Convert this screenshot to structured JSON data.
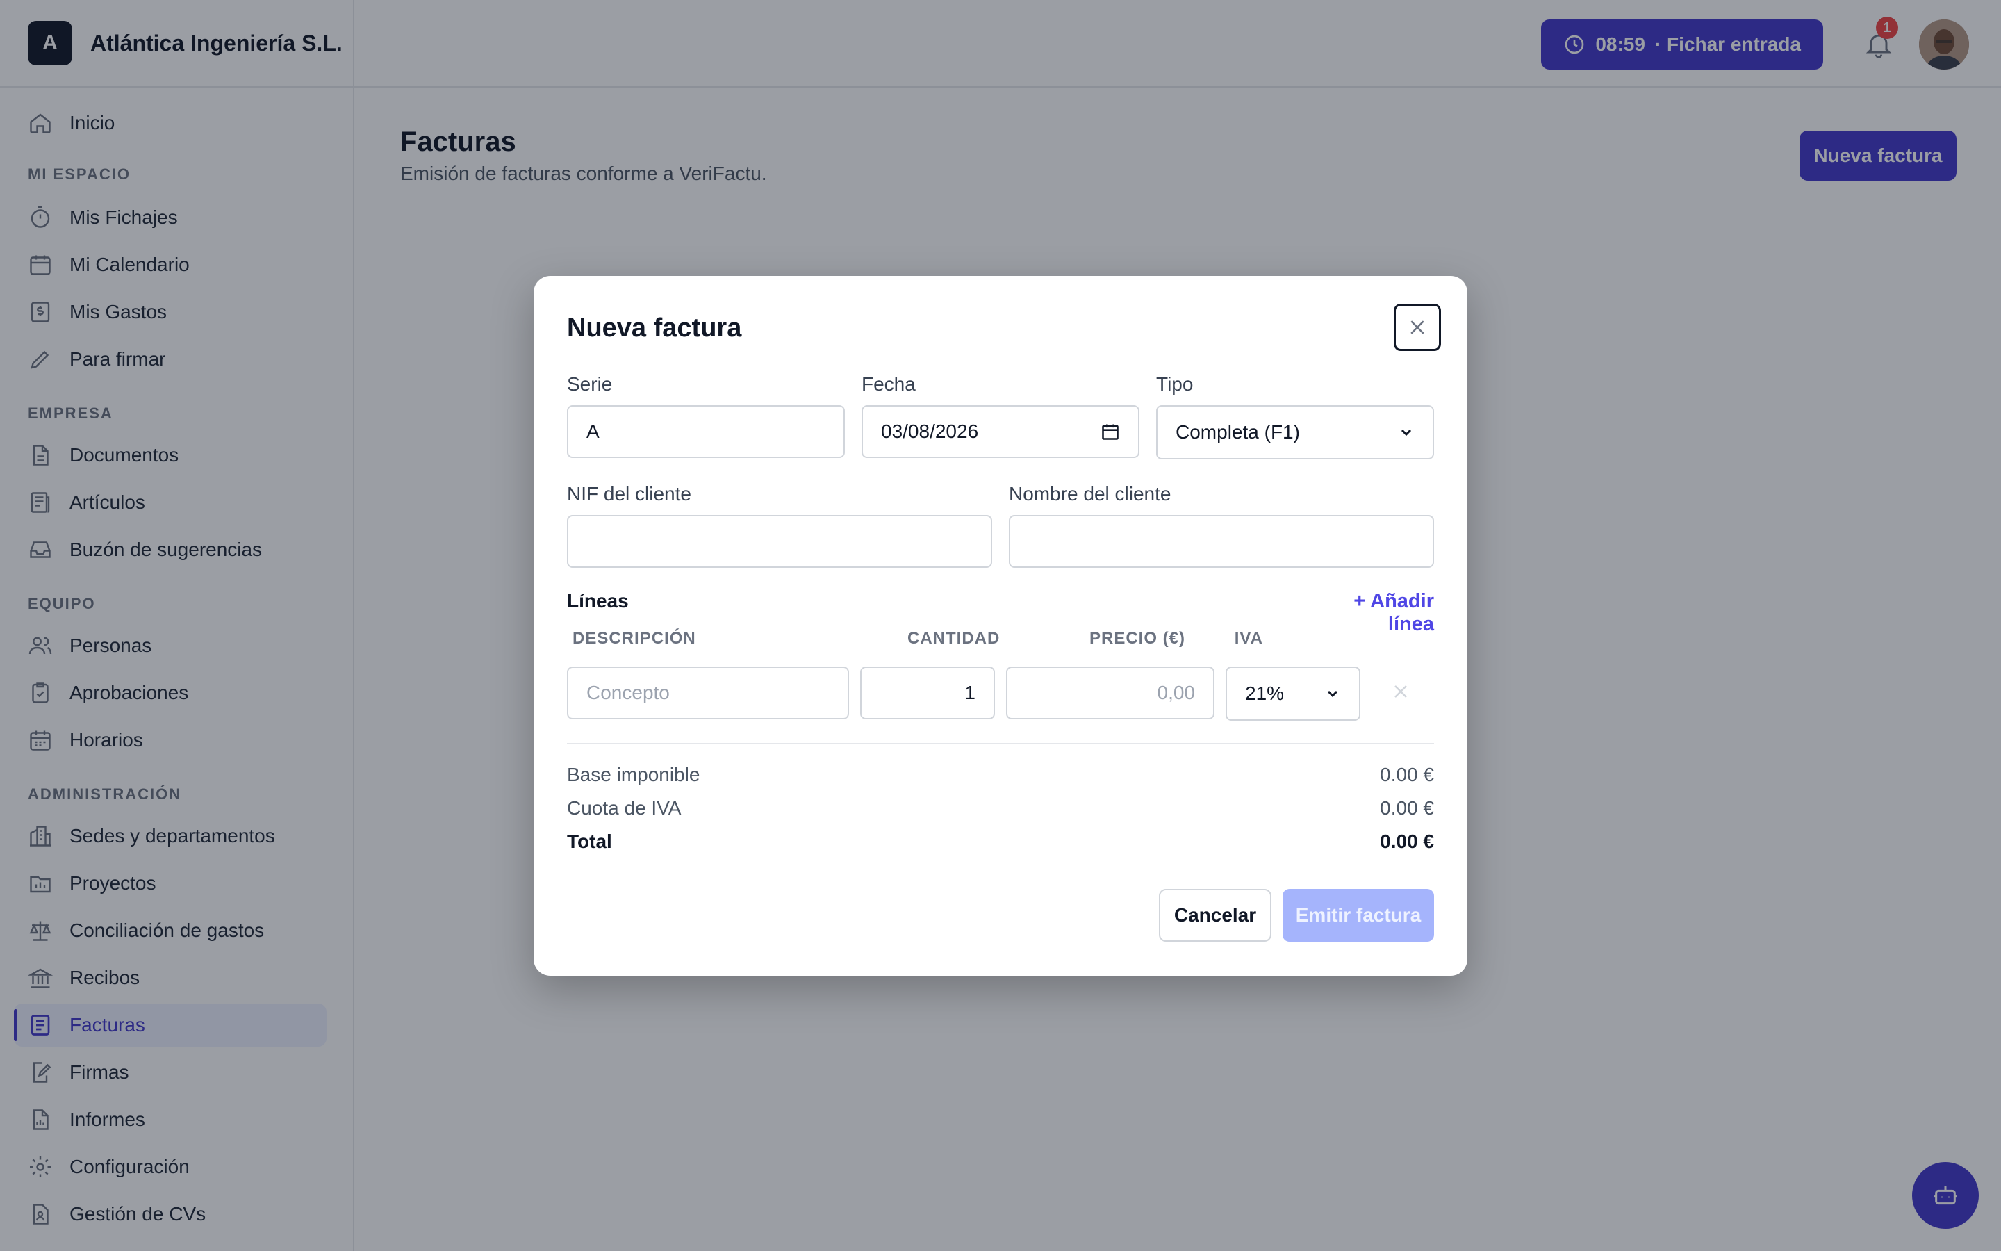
{
  "company": {
    "logo_letter": "A",
    "name": "Atlántica Ingeniería S.L."
  },
  "header": {
    "clock_time": "08:59",
    "clock_action": "· Fichar entrada",
    "notifications_count": "1"
  },
  "sidebar": {
    "home": "Inicio",
    "sections": [
      {
        "title": "MI ESPACIO",
        "items": [
          "Mis Fichajes",
          "Mi Calendario",
          "Mis Gastos",
          "Para firmar"
        ]
      },
      {
        "title": "EMPRESA",
        "items": [
          "Documentos",
          "Artículos",
          "Buzón de sugerencias"
        ]
      },
      {
        "title": "EQUIPO",
        "items": [
          "Personas",
          "Aprobaciones",
          "Horarios"
        ]
      },
      {
        "title": "ADMINISTRACIÓN",
        "items": [
          "Sedes y departamentos",
          "Proyectos",
          "Conciliación de gastos",
          "Recibos",
          "Facturas",
          "Firmas",
          "Informes",
          "Configuración",
          "Gestión de CVs"
        ]
      }
    ],
    "active_item": "Facturas"
  },
  "page": {
    "title": "Facturas",
    "subtitle": "Emisión de facturas conforme a VeriFactu.",
    "new_button": "Nueva factura"
  },
  "modal": {
    "title": "Nueva factura",
    "serie_label": "Serie",
    "serie_value": "A",
    "fecha_label": "Fecha",
    "fecha_value": "03/08/2026",
    "tipo_label": "Tipo",
    "tipo_value": "Completa (F1)",
    "nif_label": "NIF del cliente",
    "nif_value": "",
    "nombre_label": "Nombre del cliente",
    "nombre_value": "",
    "lines_title": "Líneas",
    "add_line": "+ Añadir línea",
    "columns": {
      "descripcion": "DESCRIPCIÓN",
      "cantidad": "CANTIDAD",
      "precio": "PRECIO (€)",
      "iva": "IVA"
    },
    "line": {
      "concepto_placeholder": "Concepto",
      "cantidad": "1",
      "precio_placeholder": "0,00",
      "iva": "21%"
    },
    "summary": {
      "base_label": "Base imponible",
      "base_value": "0.00 €",
      "cuota_label": "Cuota de IVA",
      "cuota_value": "0.00 €",
      "total_label": "Total",
      "total_value": "0.00 €"
    },
    "cancel_button": "Cancelar",
    "emit_button": "Emitir factura"
  },
  "colors": {
    "accent": "#4338ca",
    "accent_light": "#a5b4fc",
    "badge": "#ef4444"
  }
}
